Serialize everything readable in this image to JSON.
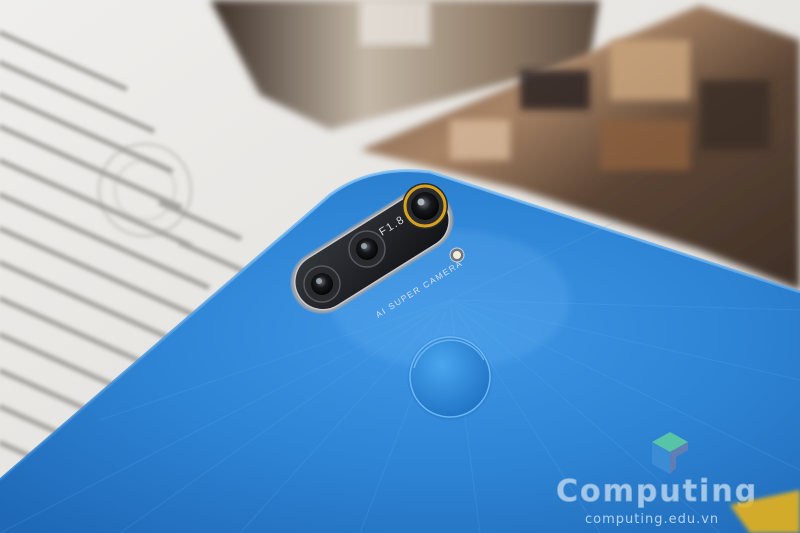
{
  "phone": {
    "aperture_label": "F1.8",
    "camera_label": "AI SUPER CAMERA",
    "body_color": "#2f86d6",
    "module_color": "#1d1f24",
    "ring_color": "#d7a21c"
  },
  "watermark": {
    "brand": "Computing",
    "url": "computing.edu.vn",
    "icon": "c-cube-logo-icon",
    "color": "#a9c9e8"
  }
}
